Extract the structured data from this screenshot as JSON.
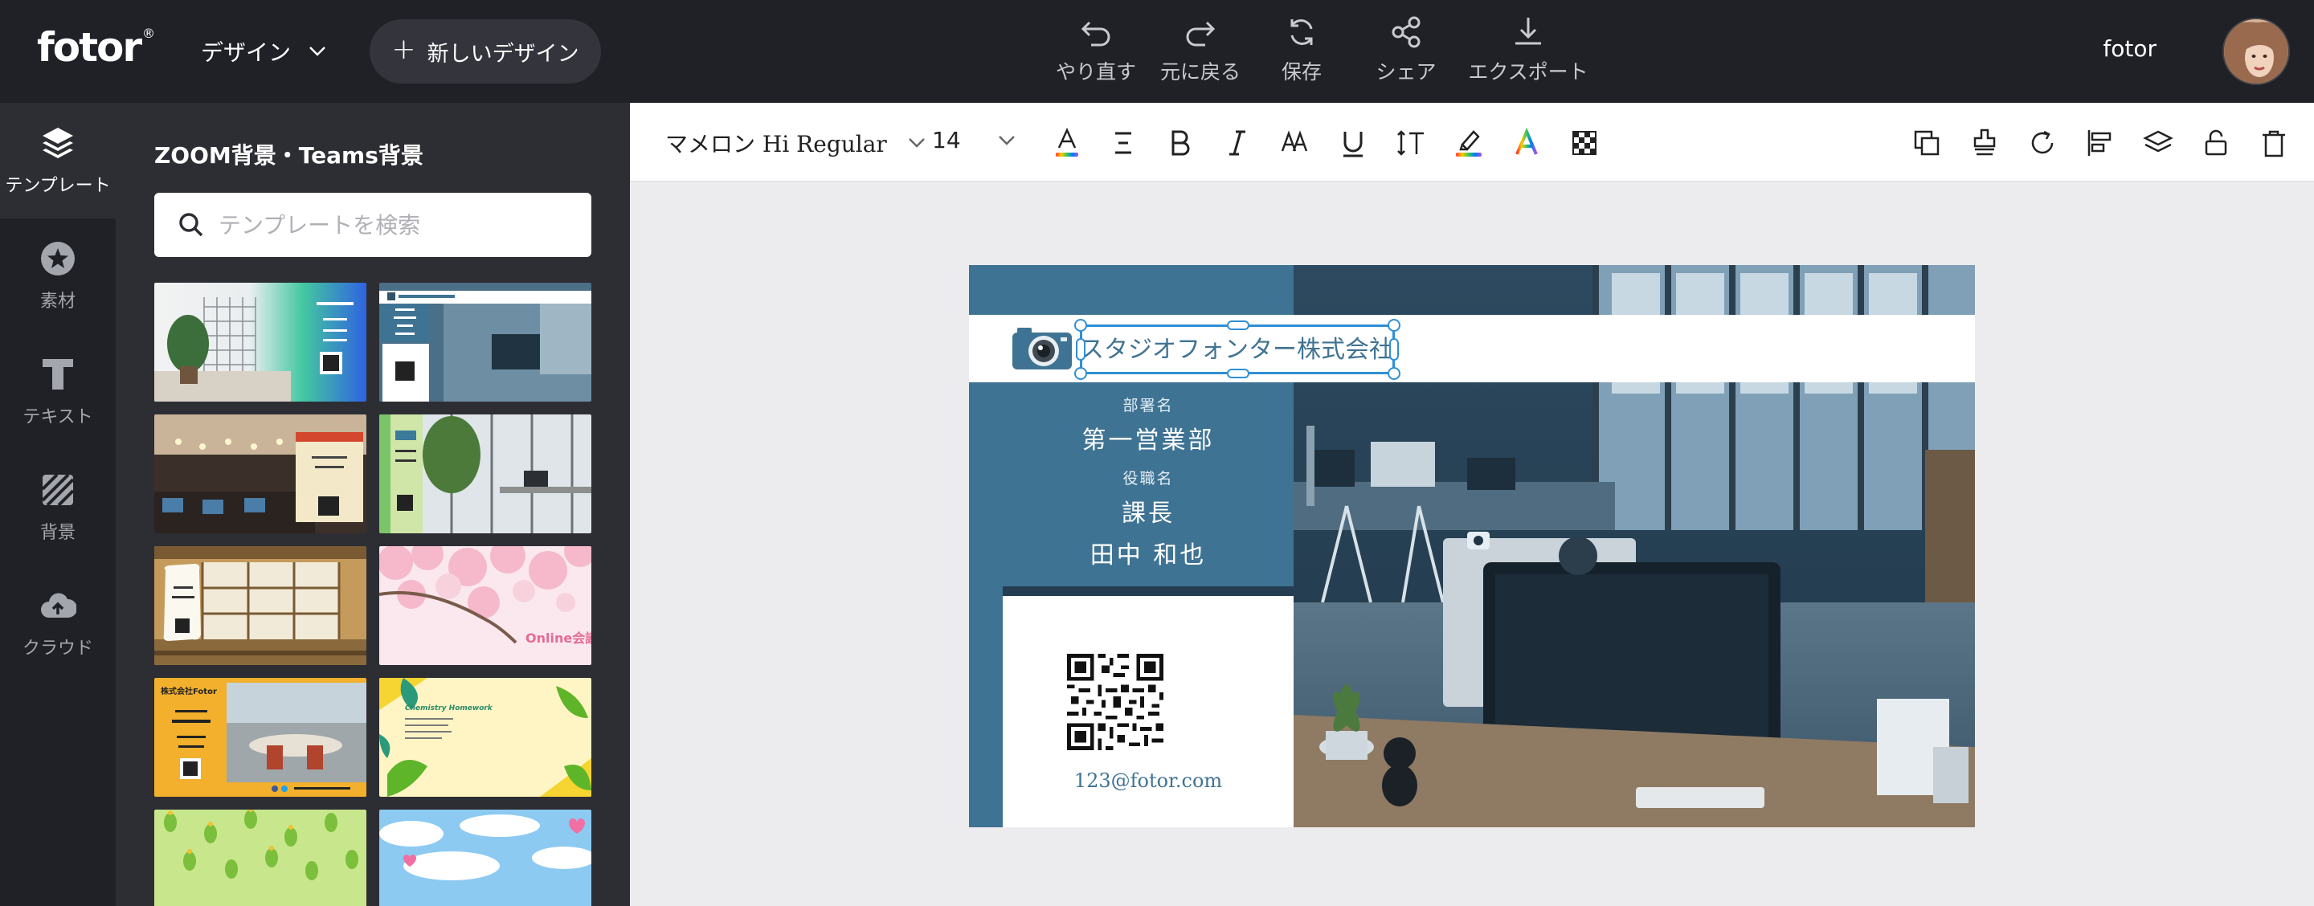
{
  "topbar": {
    "logo": "fotor",
    "logo_mark": "®",
    "design_menu": "デザイン",
    "new_design": "新しいデザイン",
    "actions": {
      "undo": "やり直す",
      "redo": "元に戻る",
      "save": "保存",
      "share": "シェア",
      "export": "エクスポート"
    },
    "user_name": "fotor"
  },
  "rail": {
    "items": [
      {
        "label": "テンプレート",
        "icon": "layers-icon",
        "active": true
      },
      {
        "label": "素材",
        "icon": "star-icon",
        "active": false
      },
      {
        "label": "テキスト",
        "icon": "text-icon",
        "active": false
      },
      {
        "label": "背景",
        "icon": "background-pattern-icon",
        "active": false
      },
      {
        "label": "クラウド",
        "icon": "cloud-upload-icon",
        "active": false
      }
    ]
  },
  "panel": {
    "title": "ZOOM背景・Teams背景",
    "search_placeholder": "テンプレートを検索",
    "thumbnails": [
      {
        "id": "t1",
        "text": ""
      },
      {
        "id": "t2",
        "text": ""
      },
      {
        "id": "t3",
        "text": ""
      },
      {
        "id": "t4",
        "text": ""
      },
      {
        "id": "t5",
        "text": ""
      },
      {
        "id": "t6",
        "text": "Online会議"
      },
      {
        "id": "t7",
        "text": "株式会社Fotor"
      },
      {
        "id": "t8",
        "text": "Chemistry Homework"
      },
      {
        "id": "t9",
        "text": ""
      },
      {
        "id": "t10",
        "text": ""
      }
    ]
  },
  "text_toolbar": {
    "font_family": "マメロン Hi Regular",
    "font_size": "14"
  },
  "card": {
    "company": "スタジオフォンター株式会社",
    "dept_label": "部署名",
    "dept": "第一営業部",
    "role_label": "役職名",
    "role": "課長",
    "name": "田中 和也",
    "email": "123@fotor.com"
  },
  "colors": {
    "topbar_bg": "#202127",
    "panel_bg": "#2d2e34",
    "workspace_bg": "#ececef",
    "card_blue": "#3f7393",
    "selection": "#2f8fd6"
  }
}
